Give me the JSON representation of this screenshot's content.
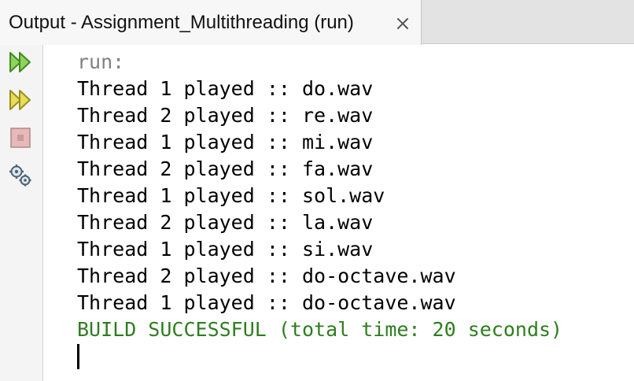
{
  "tab": {
    "title": "Output - Assignment_Multithreading (run)",
    "close_glyph": "×"
  },
  "toolbar": {
    "icons": [
      "rerun-icon",
      "rerun-with-options-icon",
      "stop-icon",
      "settings-icon"
    ]
  },
  "console": {
    "lines": [
      {
        "text": "run:",
        "kind": "meta"
      },
      {
        "text": "Thread 1 played :: do.wav",
        "kind": "output"
      },
      {
        "text": "Thread 2 played :: re.wav",
        "kind": "output"
      },
      {
        "text": "Thread 1 played :: mi.wav",
        "kind": "output"
      },
      {
        "text": "Thread 2 played :: fa.wav",
        "kind": "output"
      },
      {
        "text": "Thread 1 played :: sol.wav",
        "kind": "output"
      },
      {
        "text": "Thread 2 played :: la.wav",
        "kind": "output"
      },
      {
        "text": "Thread 1 played :: si.wav",
        "kind": "output"
      },
      {
        "text": "Thread 2 played :: do-octave.wav",
        "kind": "output"
      },
      {
        "text": "Thread 1 played :: do-octave.wav",
        "kind": "output"
      },
      {
        "text": "BUILD SUCCESSFUL (total time: 20 seconds)",
        "kind": "success"
      }
    ]
  },
  "colors": {
    "meta": "#808080",
    "output": "#000000",
    "success": "#2e7d1f",
    "rerun": "#4aa322"
  }
}
